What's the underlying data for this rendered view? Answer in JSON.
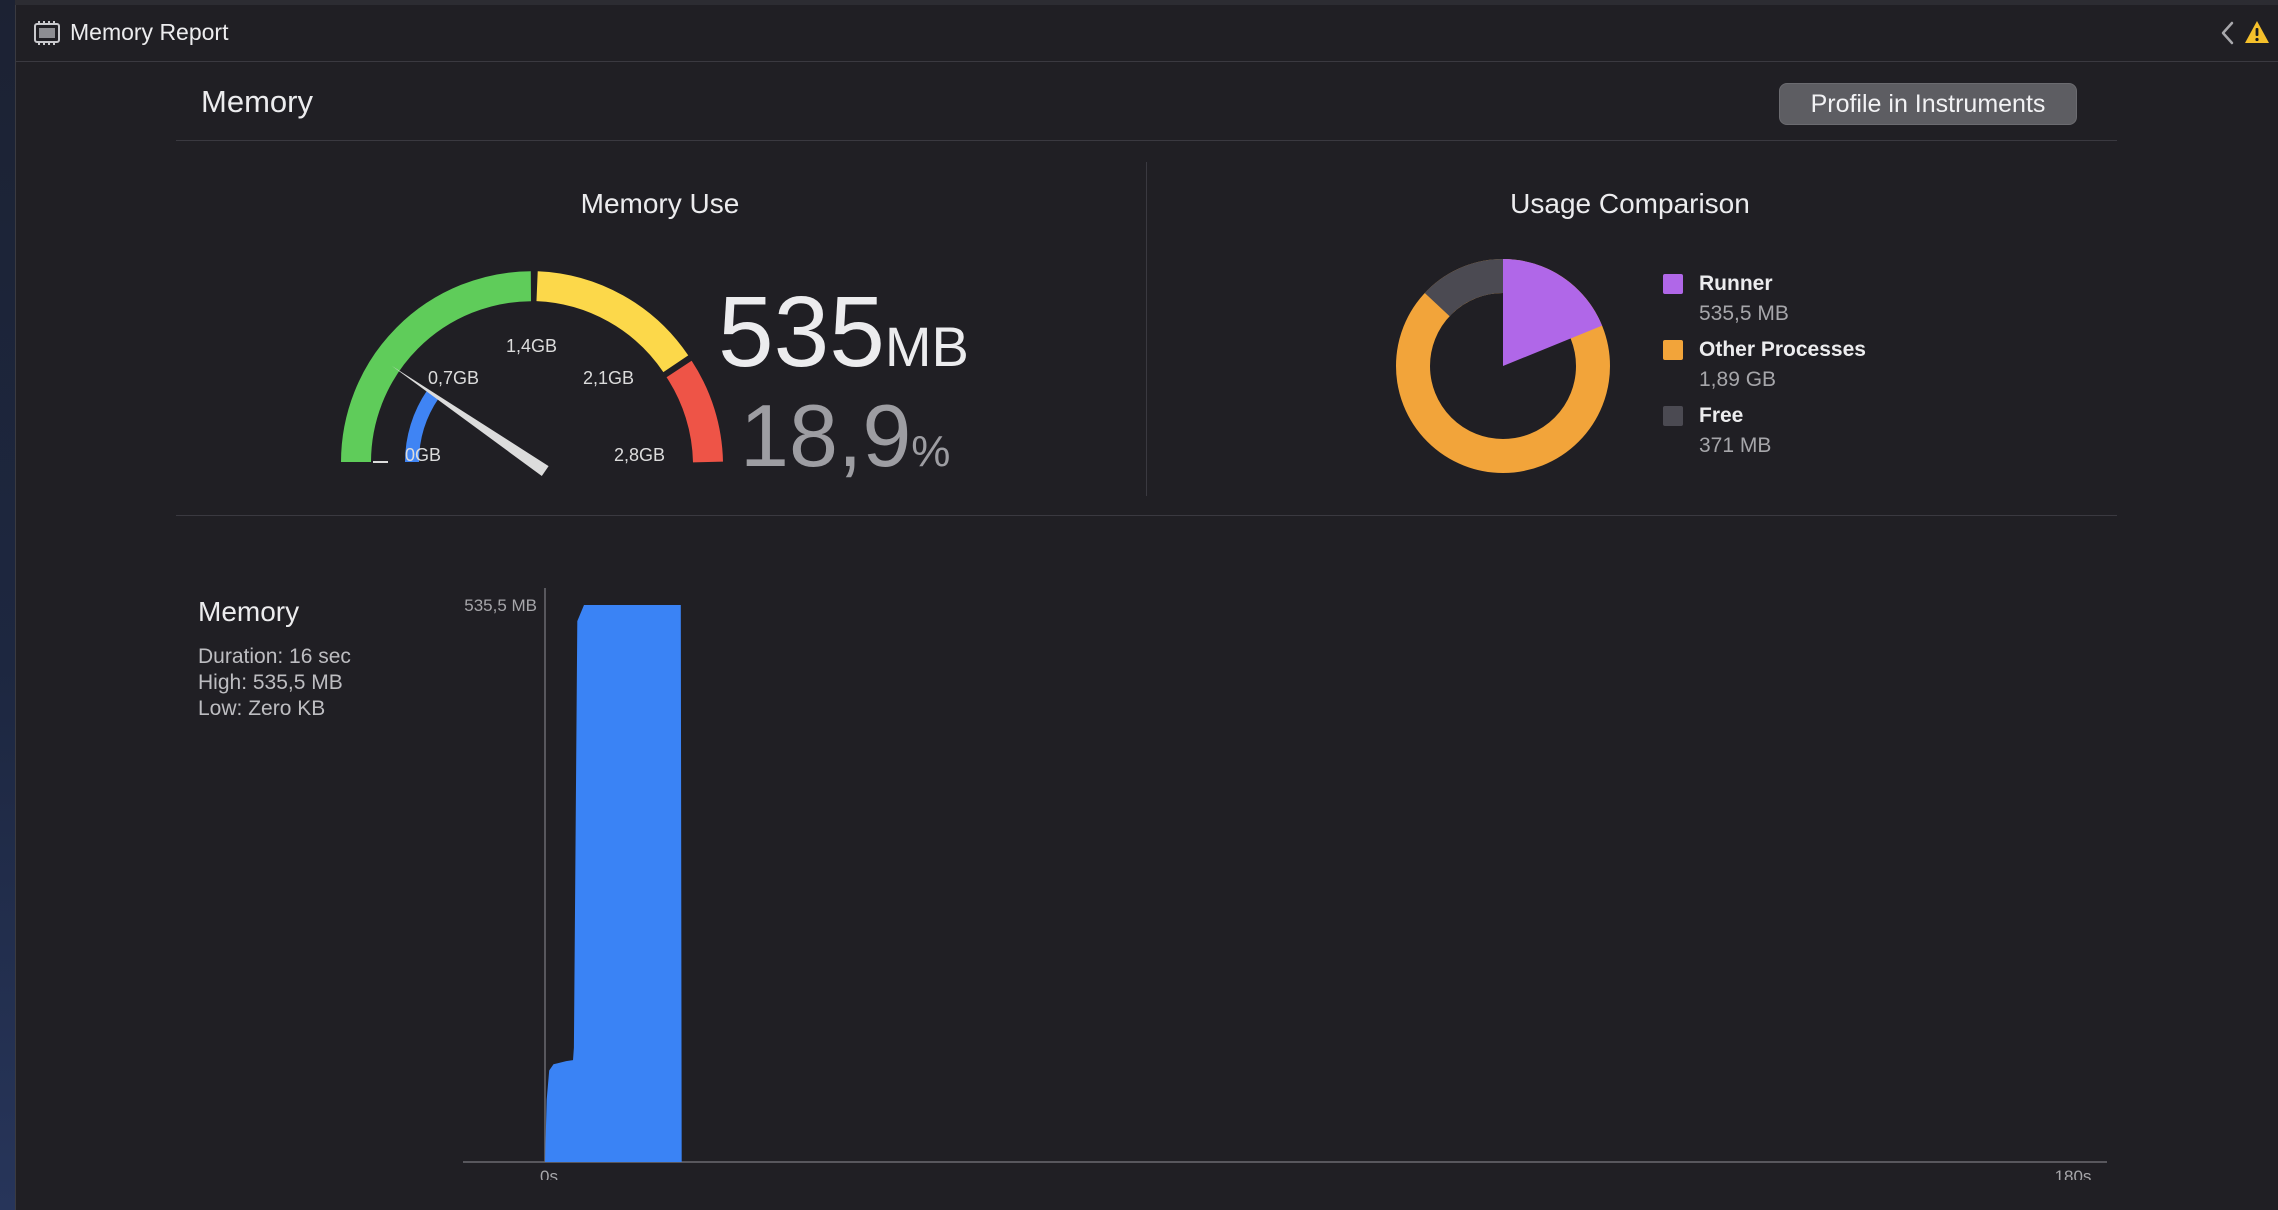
{
  "window": {
    "title": "Memory Report"
  },
  "header": {
    "title": "Memory",
    "profile_button": "Profile in Instruments"
  },
  "memory_use": {
    "title": "Memory Use",
    "value": "535",
    "unit": "MB",
    "percent": "18,9",
    "percent_unit": "%",
    "gauge_labels": [
      "0GB",
      "0,7GB",
      "1,4GB",
      "2,1GB",
      "2,8GB"
    ],
    "gauge_max_gb": 2.8,
    "current_gb": 0.5355,
    "colors": {
      "green": "#5fcc5a",
      "yellow": "#fcd84a",
      "red": "#ee5447",
      "blue": "#3f84f4",
      "needle": "#dcdcdc"
    }
  },
  "usage_comparison": {
    "title": "Usage Comparison",
    "legend": [
      {
        "name": "Runner",
        "value": "535,5 MB",
        "color": "#b067e8",
        "mb": 535.5
      },
      {
        "name": "Other Processes",
        "value": "1,89 GB",
        "color": "#f2a43a",
        "mb": 1935
      },
      {
        "name": "Free",
        "value": "371 MB",
        "color": "#4b4a52",
        "mb": 371
      }
    ]
  },
  "memory_stats": {
    "title": "Memory",
    "duration": "Duration: 16 sec",
    "high": "High: 535,5 MB",
    "low": "Low: Zero KB"
  },
  "chart_data": {
    "type": "area",
    "y_max_label": "535,5 MB",
    "x_start_label": "0s",
    "x_end_label": "180s",
    "xlim": [
      0,
      180
    ],
    "ylim": [
      0,
      535.5
    ],
    "color": "#3a83f5",
    "x": [
      0,
      0.2,
      0.5,
      1.0,
      1.5,
      2.5,
      3.3,
      3.4,
      3.8,
      4.6,
      5.1,
      11.5,
      11.7,
      16.0,
      16.1
    ],
    "y": [
      0,
      60,
      88,
      94,
      95,
      97,
      98,
      110,
      520,
      535.5,
      535.5,
      535.5,
      535.5,
      535.5,
      0
    ]
  }
}
